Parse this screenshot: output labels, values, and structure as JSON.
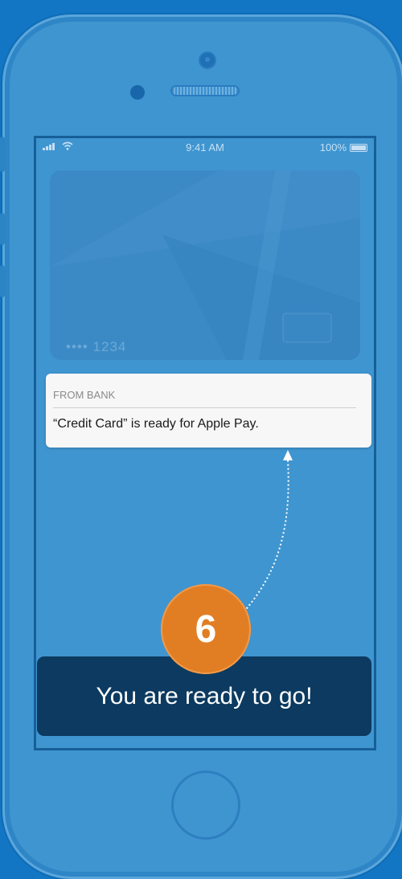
{
  "status_bar": {
    "time": "9:41 AM",
    "battery": "100%",
    "wifi_icon": "wifi-icon",
    "signal_icon": "signal-icon"
  },
  "card": {
    "number": "•••• 1234"
  },
  "notification": {
    "header": "FROM BANK",
    "message": "“Credit Card” is ready for Apple Pay."
  },
  "step": {
    "number": "6",
    "caption": "You are ready to go!"
  },
  "colors": {
    "background": "#1276c4",
    "phone": "#3f95d0",
    "badge": "#e17e24",
    "caption_bg": "#0c3a60"
  }
}
